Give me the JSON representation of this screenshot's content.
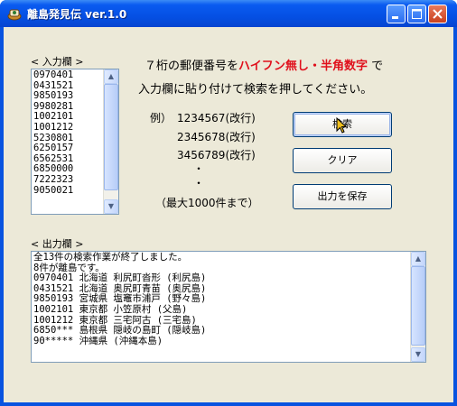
{
  "window": {
    "title": "離島発見伝 ver.1.0"
  },
  "input_section": {
    "label": "< 入力欄 >",
    "lines": [
      "0970401",
      "0431521",
      "9850193",
      "9980281",
      "1002101",
      "1001212",
      "5230801",
      "6250157",
      "6562531",
      "6850000",
      "7222323",
      "9050021"
    ]
  },
  "instructions": {
    "line1_pre": "７桁の郵便番号を",
    "line1_highlight": "ハイフン無し・半角数字",
    "line1_post": "で",
    "line2": "入力欄に貼り付けて検索を押してください。",
    "example_label": "例）",
    "example1": "1234567(改行)",
    "example2": "2345678(改行)",
    "example3": "3456789(改行)",
    "dot1": "・",
    "dot2": "・",
    "max_note": "（最大1000件まで）"
  },
  "buttons": {
    "search": "検索",
    "clear": "クリア",
    "save": "出力を保存"
  },
  "output_section": {
    "label": "< 出力欄 >",
    "lines": [
      "全13件の検索作業が終了しました。",
      "8件が離島です。",
      "0970401 北海道 利尻町沓形 (利尻島)",
      "0431521 北海道 奥尻町青苗 (奥尻島)",
      "9850193 宮城県 塩竈市浦戸 (野々島)",
      "1002101 東京都 小笠原村 (父島)",
      "1001212 東京都 三宅阿古 (三宅島)",
      "6850*** 島根県 隠岐の島町 (隠岐島)",
      "90***** 沖縄県 (沖縄本島)"
    ]
  },
  "colors": {
    "titlebar": "#0553e4",
    "highlight_text": "#e0101c",
    "window_bg": "#ece9d8"
  }
}
